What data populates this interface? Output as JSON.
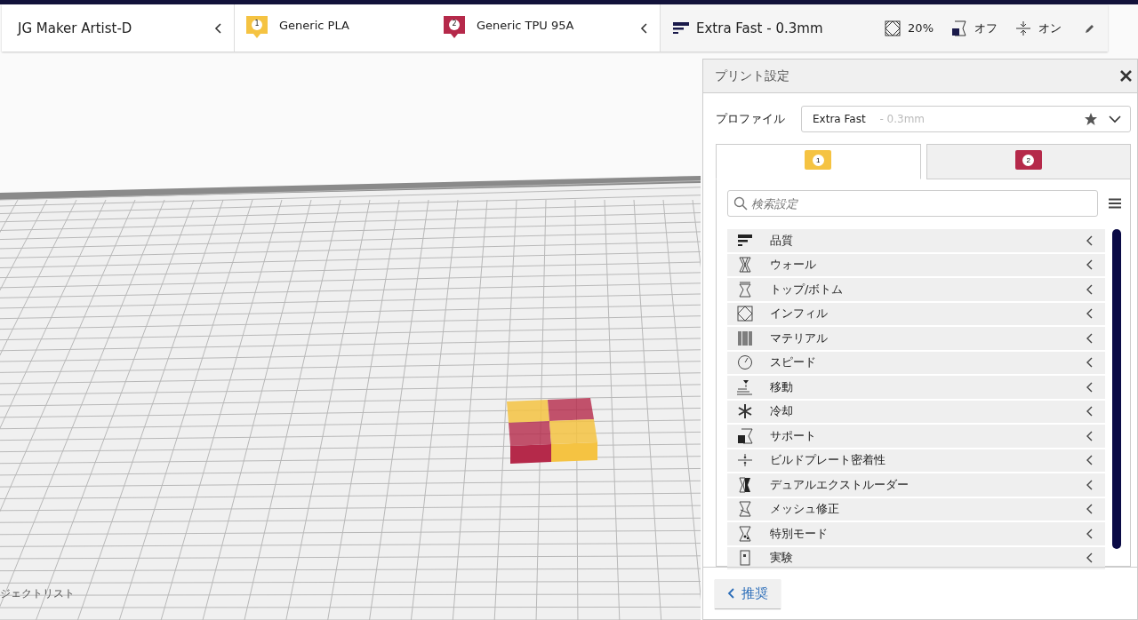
{
  "printer": {
    "name": "JG Maker Artist-D"
  },
  "extruders": [
    {
      "number": "1",
      "material": "Generic PLA",
      "color": "#f5c342"
    },
    {
      "number": "2",
      "material": "Generic TPU 95A",
      "color": "#b5294a"
    }
  ],
  "print_summary": {
    "profile": "Extra Fast - 0.3mm",
    "infill": "20%",
    "support": "オフ",
    "adhesion": "オン"
  },
  "panel": {
    "title": "プリント設定",
    "profile_label": "プロファイル",
    "profile_name": "Extra Fast",
    "profile_detail": "- 0.3mm",
    "tabs": [
      {
        "number": "1",
        "color": "#f5c342",
        "selected": true
      },
      {
        "number": "2",
        "color": "#b5294a",
        "selected": false
      }
    ],
    "search": {
      "placeholder": "検索設定"
    },
    "categories": [
      {
        "label": "品質",
        "kind": "quality"
      },
      {
        "label": "ウォール",
        "kind": "walls"
      },
      {
        "label": "トップ/ボトム",
        "kind": "topbottom"
      },
      {
        "label": "インフィル",
        "kind": "infill"
      },
      {
        "label": "マテリアル",
        "kind": "material"
      },
      {
        "label": "スピード",
        "kind": "speed"
      },
      {
        "label": "移動",
        "kind": "travel"
      },
      {
        "label": "冷却",
        "kind": "cooling"
      },
      {
        "label": "サポート",
        "kind": "support"
      },
      {
        "label": "ビルドプレート密着性",
        "kind": "adhesion"
      },
      {
        "label": "デュアルエクストルーダー",
        "kind": "dual"
      },
      {
        "label": "メッシュ修正",
        "kind": "mesh"
      },
      {
        "label": "特別モード",
        "kind": "special"
      },
      {
        "label": "実験",
        "kind": "experimental"
      }
    ],
    "recommended_button": "推奨"
  },
  "object_list": {
    "label": "ジェクトリスト"
  }
}
